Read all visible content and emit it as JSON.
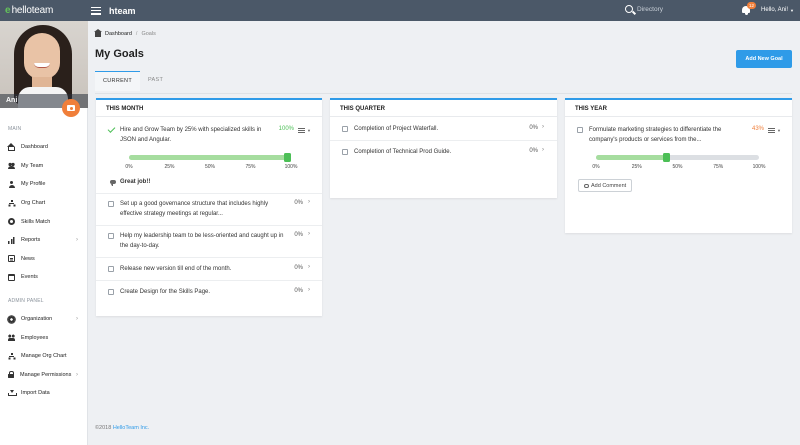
{
  "topbar": {
    "logo_mark": "e",
    "logo_text": "helloteam",
    "app_name": "hteam",
    "search_placeholder": "Directory",
    "notification_count": "12",
    "user_greeting": "Hello, Ani!"
  },
  "sidebar": {
    "profile_name": "Ani",
    "main_title": "MAIN",
    "main_items": [
      {
        "label": "Dashboard"
      },
      {
        "label": "My Team"
      },
      {
        "label": "My Profile"
      },
      {
        "label": "Org Chart"
      },
      {
        "label": "Skills Match"
      },
      {
        "label": "Reports"
      },
      {
        "label": "News"
      },
      {
        "label": "Events"
      }
    ],
    "admin_title": "ADMIN PANEL",
    "admin_items": [
      {
        "label": "Organization"
      },
      {
        "label": "Employees"
      },
      {
        "label": "Manage Org Chart"
      },
      {
        "label": "Manage Permissions"
      },
      {
        "label": "Import Data"
      }
    ]
  },
  "breadcrumb": {
    "home": "Dashboard",
    "separator": "/",
    "current": "Goals"
  },
  "page": {
    "title": "My Goals",
    "add_button": "Add New Goal"
  },
  "tabs": [
    {
      "label": "CURRENT"
    },
    {
      "label": "PAST"
    }
  ],
  "scale_labels": [
    "0%",
    "25%",
    "50%",
    "75%",
    "100%"
  ],
  "month": {
    "title": "THIS MONTH",
    "goals": [
      {
        "text": "Hire and Grow Team by 25% with specialized skills in JSON and Angular.",
        "pct": "100%",
        "progress": 1.0,
        "comment": "Great job!!"
      },
      {
        "text": "Set up a good governance structure that includes highly effective strategy meetings at regular...",
        "pct": "0%"
      },
      {
        "text": "Help my leadership team to be less-oriented and caught up in the day-to-day.",
        "pct": "0%"
      },
      {
        "text": "Release new version till end of the month.",
        "pct": "0%"
      },
      {
        "text": "Create Design for the Skills Page.",
        "pct": "0%"
      }
    ]
  },
  "quarter": {
    "title": "THIS QUARTER",
    "goals": [
      {
        "text": "Completion of Project Waterfall.",
        "pct": "0%"
      },
      {
        "text": "Completion of Technical Prod Guide.",
        "pct": "0%"
      }
    ]
  },
  "year": {
    "title": "THIS YEAR",
    "goals": [
      {
        "text": "Formulate marketing strategies to differentiate the company's products or services from the...",
        "pct": "43%",
        "progress": 0.43,
        "add_comment": "Add Comment"
      }
    ]
  },
  "footer": {
    "copyright": "©2018",
    "company": "HelloTeam Inc."
  },
  "colors": {
    "topbar": "#4b5868",
    "accent": "#2f9be8",
    "success": "#4cbf56",
    "warning": "#f07f3a"
  }
}
